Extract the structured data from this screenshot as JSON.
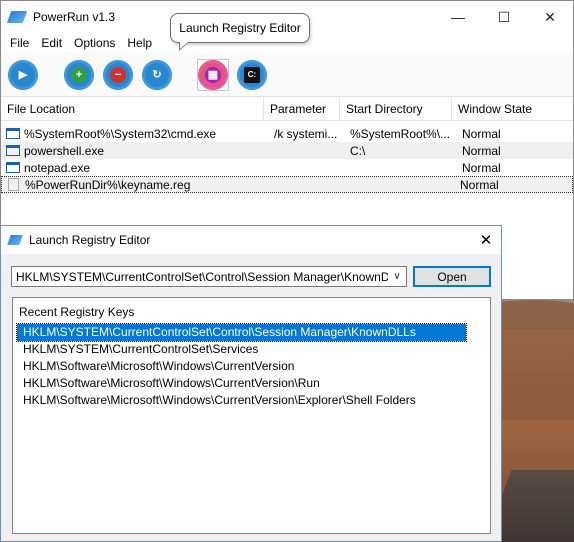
{
  "main_window": {
    "title": "PowerRun v1.3",
    "controls": {
      "minimize": "—",
      "maximize": "☐",
      "close": "✕"
    },
    "menu": [
      "File",
      "Edit",
      "Options",
      "Help"
    ],
    "toolbar": [
      {
        "name": "run-icon",
        "glyph": "▶"
      },
      {
        "name": "add-icon",
        "glyph": "+"
      },
      {
        "name": "remove-icon",
        "glyph": "−"
      },
      {
        "name": "refresh-icon",
        "glyph": "↻"
      },
      {
        "name": "registry-editor-icon",
        "glyph": "▦"
      },
      {
        "name": "command-prompt-icon",
        "glyph": "C:"
      }
    ],
    "tooltip": "Launch Registry Editor",
    "columns": [
      "File Location",
      "Parameter",
      "Start Directory",
      "Window State"
    ],
    "rows": [
      {
        "file": "%SystemRoot%\\System32\\cmd.exe",
        "parameter": "/k systemi...",
        "start_dir": "%SystemRoot%\\...",
        "state": "Normal"
      },
      {
        "file": "powershell.exe",
        "parameter": "",
        "start_dir": "C:\\",
        "state": "Normal"
      },
      {
        "file": "notepad.exe",
        "parameter": "",
        "start_dir": "",
        "state": "Normal"
      },
      {
        "file": "%PowerRunDir%\\keyname.reg",
        "parameter": "",
        "start_dir": "",
        "state": "Normal"
      }
    ]
  },
  "dialog": {
    "title": "Launch Registry Editor",
    "close": "✕",
    "combo_value": "HKLM\\SYSTEM\\CurrentControlSet\\Control\\Session Manager\\KnownDLLs",
    "open_label": "Open",
    "list_header": "Recent Registry Keys",
    "items": [
      "HKLM\\SYSTEM\\CurrentControlSet\\Control\\Session Manager\\KnownDLLs",
      "HKLM\\SYSTEM\\CurrentControlSet\\Services",
      "HKLM\\Software\\Microsoft\\Windows\\CurrentVersion",
      "HKLM\\Software\\Microsoft\\Windows\\CurrentVersion\\Run",
      "HKLM\\Software\\Microsoft\\Windows\\CurrentVersion\\Explorer\\Shell Folders"
    ],
    "selected_index": 0
  },
  "colors": {
    "accent": "#0078d7",
    "toolbar_gear": "#2a86cf"
  }
}
